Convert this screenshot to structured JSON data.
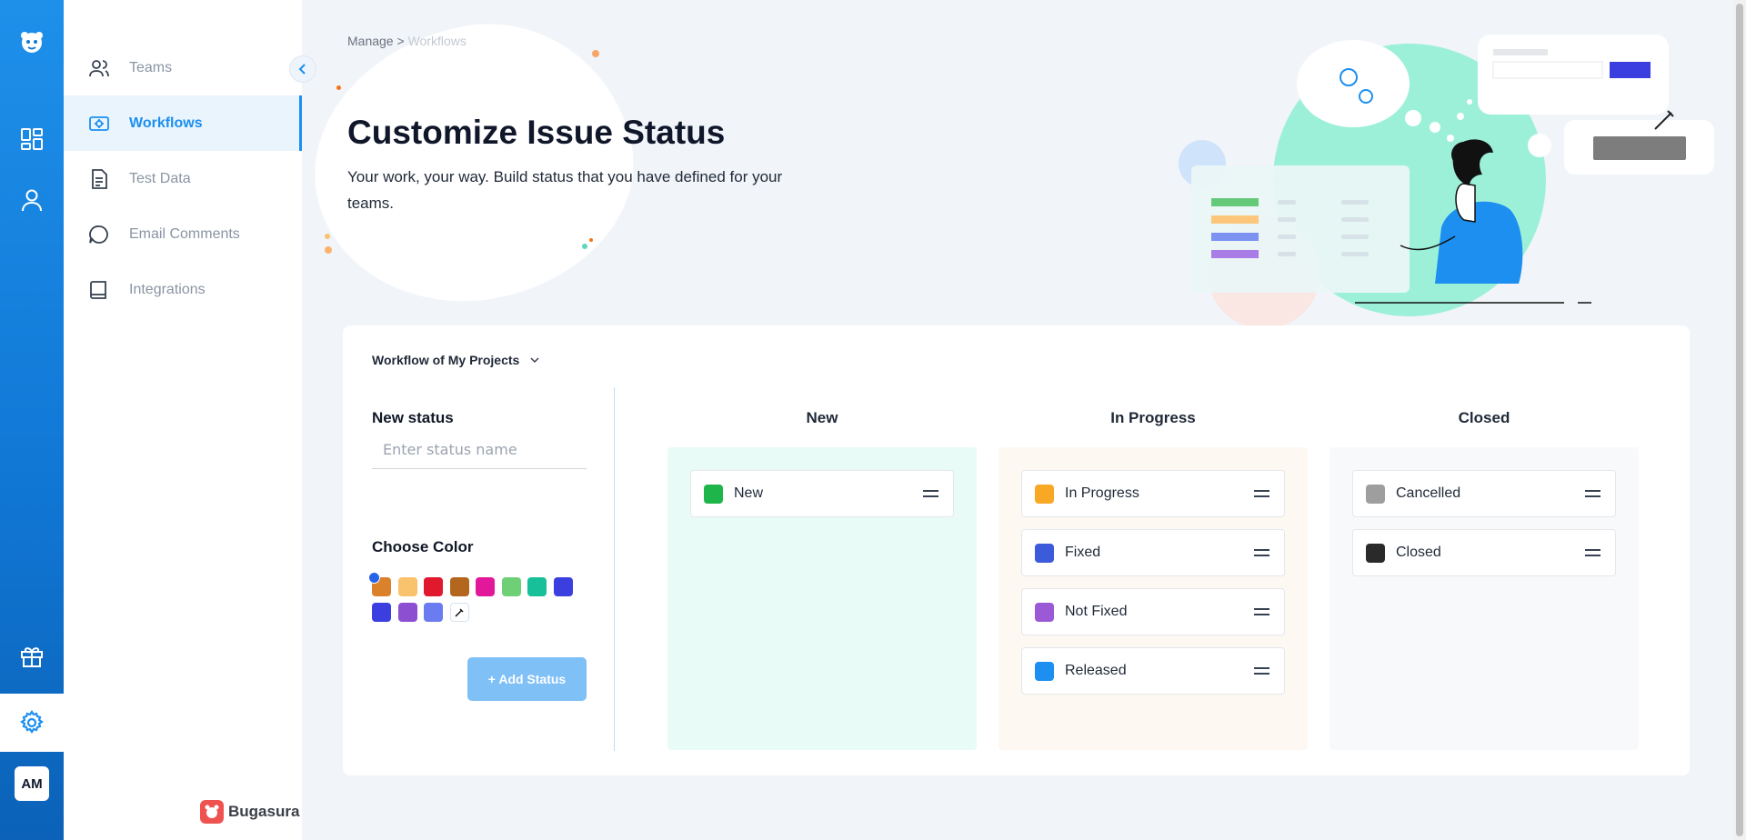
{
  "rail": {
    "items": [
      {
        "name": "bugasura-logo-icon"
      },
      {
        "name": "dashboard-icon"
      },
      {
        "name": "user-icon"
      },
      {
        "name": "gift-icon"
      },
      {
        "name": "settings-icon"
      }
    ],
    "avatar_initials": "AM"
  },
  "sidebar": {
    "items": [
      {
        "label": "Teams",
        "icon": "users-icon",
        "active": false
      },
      {
        "label": "Workflows",
        "icon": "workflow-icon",
        "active": true
      },
      {
        "label": "Test Data",
        "icon": "document-icon",
        "active": false
      },
      {
        "label": "Email Comments",
        "icon": "chat-icon",
        "active": false
      },
      {
        "label": "Integrations",
        "icon": "book-icon",
        "active": false
      }
    ],
    "brand": "Bugasura"
  },
  "breadcrumb": {
    "parent": "Manage",
    "separator": " > ",
    "current": "Workflows"
  },
  "hero": {
    "title": "Customize Issue Status",
    "subtitle": "Your work, your way. Build status that you have defined for your teams."
  },
  "card": {
    "workflow_select": "Workflow of My Projects",
    "new_status_label": "New status",
    "input_placeholder": "Enter status name",
    "choose_color_label": "Choose Color",
    "colors": [
      "#d9822b",
      "#f9c26c",
      "#e0192e",
      "#b2661e",
      "#e2189a",
      "#6fcf76",
      "#18c09a",
      "#3b3fe0",
      "#3b3fe0",
      "#8c4fd1",
      "#6b7cf0"
    ],
    "selected_color_index": 0,
    "add_button": "+ Add Status",
    "columns": [
      {
        "title": "New",
        "bg": "#e9fbf7",
        "items": [
          {
            "label": "New",
            "color": "#1eb64a"
          }
        ]
      },
      {
        "title": "In Progress",
        "bg": "#fdf8f1",
        "items": [
          {
            "label": "In Progress",
            "color": "#f8a825"
          },
          {
            "label": "Fixed",
            "color": "#3b5bdb"
          },
          {
            "label": "Not Fixed",
            "color": "#9b59d6"
          },
          {
            "label": "Released",
            "color": "#1c8ff0"
          }
        ]
      },
      {
        "title": "Closed",
        "bg": "#f8f9fb",
        "items": [
          {
            "label": "Cancelled",
            "color": "#9e9e9e"
          },
          {
            "label": "Closed",
            "color": "#2a2a2a"
          }
        ]
      }
    ]
  },
  "colors": {
    "accent": "#1c8ff0",
    "rail": "#1178d6",
    "button": "#7fc0f7"
  }
}
